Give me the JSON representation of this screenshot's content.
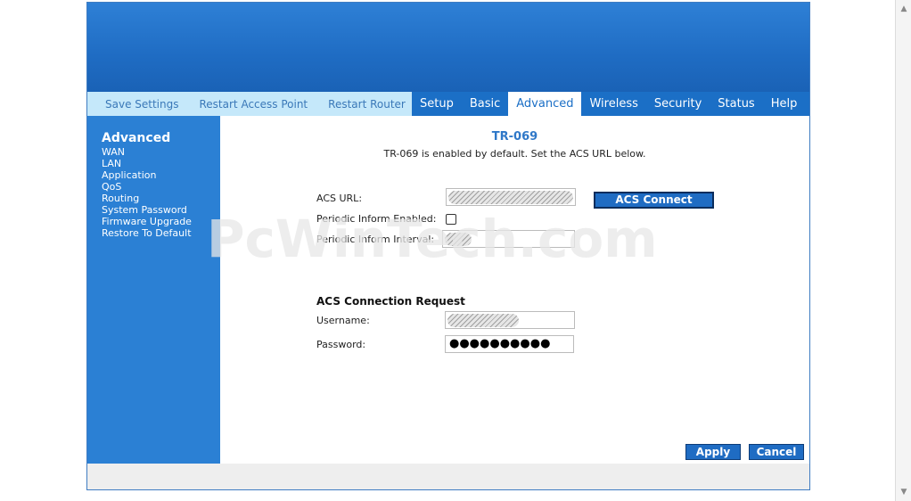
{
  "nav": {
    "links": [
      "Save Settings",
      "Restart Access Point",
      "Restart Router"
    ],
    "tabs": [
      "Setup",
      "Basic",
      "Advanced",
      "Wireless",
      "Security",
      "Status",
      "Help"
    ],
    "active_tab": "Advanced"
  },
  "sidebar": {
    "title": "Advanced",
    "items": [
      "WAN",
      "LAN",
      "Application",
      "QoS",
      "Routing",
      "System Password",
      "Firmware Upgrade",
      "Restore To Default"
    ]
  },
  "content": {
    "heading": "TR-069",
    "description": "TR-069 is enabled by default. Set the ACS URL below.",
    "acs_url_label": "ACS URL:",
    "acs_connect_button": "ACS Connect",
    "periodic_enabled_label": "Periodic Inform Enabled:",
    "periodic_enabled_checked": false,
    "periodic_interval_label": "Periodic Inform Interval:",
    "section_title": "ACS Connection Request",
    "username_label": "Username:",
    "password_label": "Password:",
    "password_value": "●●●●●●●●●●",
    "apply_button": "Apply",
    "cancel_button": "Cancel"
  },
  "watermark": "PcWinTech.com",
  "colors": {
    "brand_blue": "#1b6fc6",
    "sidebar_blue": "#2b80d4",
    "light_nav": "#c5e8fa",
    "heading_blue": "#2f78c8"
  }
}
